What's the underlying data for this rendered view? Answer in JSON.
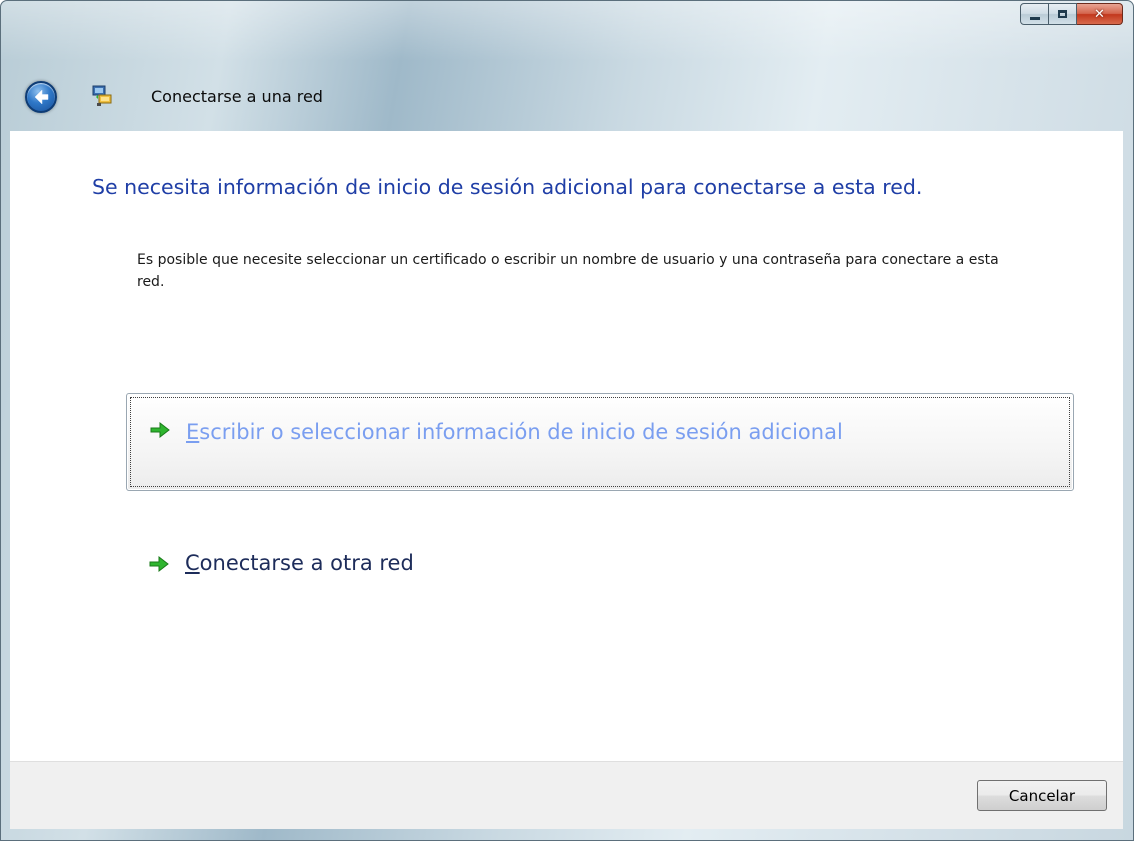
{
  "window": {
    "title": "Conectarse a una red",
    "caption_buttons": {
      "minimize": "minimize-icon",
      "maximize": "maximize-icon",
      "close": "close-icon"
    }
  },
  "content": {
    "heading": "Se necesita información de inicio de sesión adicional para conectarse a esta red.",
    "description": "Es posible que necesite seleccionar un certificado o escribir un nombre de usuario y una contraseña para conectare a esta red."
  },
  "options": [
    {
      "accesskey": "E",
      "label_rest": "scribir o seleccionar información de inicio de sesión adicional",
      "icon": "green-arrow-icon",
      "focused": true,
      "color": "#7a9ef0"
    },
    {
      "accesskey": "C",
      "label_rest": "onectarse a otra red",
      "icon": "green-arrow-icon",
      "focused": false,
      "color": "#1d2c5a"
    }
  ],
  "footer": {
    "cancel_label": "Cancelar"
  },
  "colors": {
    "heading": "#1f3ea6",
    "arrow": "#2fb52f",
    "footer_bg": "#f0f0f0"
  }
}
